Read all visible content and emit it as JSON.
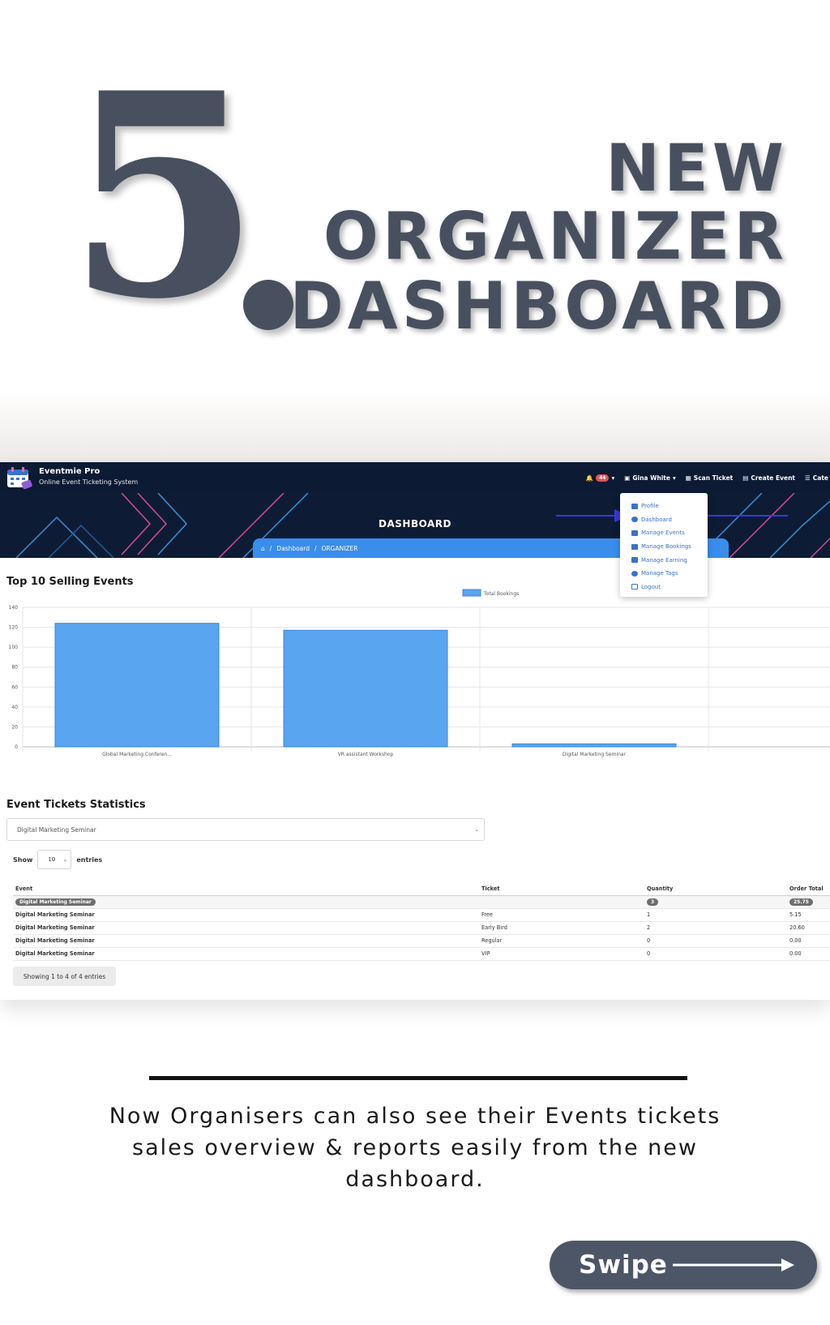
{
  "hero": {
    "number": "5",
    "line1": "NEW",
    "line2": "ORGANIZER",
    "line3": "DASHBOARD"
  },
  "app": {
    "brand_title": "Eventmie Pro",
    "brand_subtitle": "Online Event Ticketing System",
    "nav": {
      "notification_count": "44",
      "user": "Gina White",
      "scan_ticket": "Scan Ticket",
      "create_event": "Create Event",
      "categories": "Cate"
    },
    "banner_title": "DASHBOARD",
    "breadcrumb": [
      "Dashboard",
      "ORGANIZER"
    ],
    "dropdown": [
      "Profile",
      "Dashboard",
      "Manage Events",
      "Manage Bookings",
      "Manage Earning",
      "Manage Tags",
      "Logout"
    ],
    "top_selling_title": "Top 10 Selling Events",
    "stats_title": "Event Tickets Statistics",
    "event_select_value": "Digital Marketing Seminar",
    "show_label": "Show",
    "entries_value": "10",
    "entries_label": "entries",
    "table": {
      "headers": [
        "Event",
        "Ticket",
        "Quantity",
        "Order Total"
      ],
      "group": {
        "event": "Digital Marketing Seminar",
        "quantity": "3",
        "total": "25.75"
      },
      "rows": [
        {
          "event": "Digital Marketing Seminar",
          "ticket": "Free",
          "quantity": "1",
          "total": "5.15"
        },
        {
          "event": "Digital Marketing Seminar",
          "ticket": "Early Bird",
          "quantity": "2",
          "total": "20.60"
        },
        {
          "event": "Digital Marketing Seminar",
          "ticket": "Regular",
          "quantity": "0",
          "total": "0.00"
        },
        {
          "event": "Digital Marketing Seminar",
          "ticket": "VIP",
          "quantity": "0",
          "total": "0.00"
        }
      ]
    },
    "showing_info": "Showing 1 to 4 of 4 entries"
  },
  "chart_data": {
    "type": "bar",
    "title": "",
    "legend": "Total Bookings",
    "legend_position": "top",
    "categories": [
      "Global Marketing Conferen...",
      "VR assistant Workshop",
      "Digital Marketing Seminar"
    ],
    "series": [
      {
        "name": "Total Bookings",
        "values": [
          124,
          117,
          3
        ]
      }
    ],
    "ylim": [
      0,
      140
    ],
    "yticks": [
      0,
      20,
      40,
      60,
      80,
      100,
      120,
      140
    ],
    "grid": true,
    "bar_color": "#5aa5f0"
  },
  "description": "Now Organisers can also see their Events tickets sales overview & reports easily from the new dashboard.",
  "swipe_label": "Swipe",
  "colors": {
    "slate": "#48505f",
    "navy": "#0c1a33",
    "accent_blue": "#3a8ded"
  }
}
